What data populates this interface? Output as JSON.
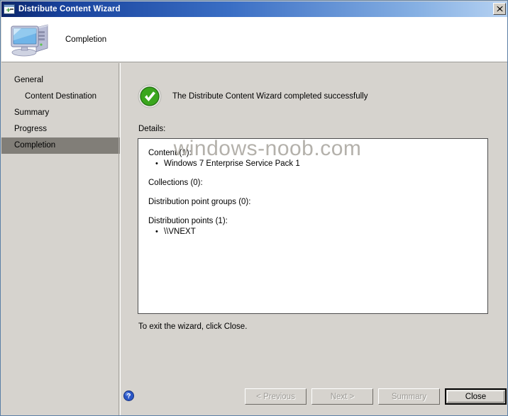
{
  "window": {
    "title": "Distribute Content Wizard",
    "title_icon": "wizard-window-icon",
    "close_label": "✕"
  },
  "header": {
    "icon": "computer-icon",
    "title": "Completion"
  },
  "sidebar": {
    "items": [
      {
        "label": "General",
        "indent": false,
        "selected": false
      },
      {
        "label": "Content Destination",
        "indent": true,
        "selected": false
      },
      {
        "label": "Summary",
        "indent": false,
        "selected": false
      },
      {
        "label": "Progress",
        "indent": false,
        "selected": false
      },
      {
        "label": "Completion",
        "indent": false,
        "selected": true
      }
    ]
  },
  "main": {
    "status_icon": "green-check-circle-icon",
    "success_message": "The Distribute Content Wizard completed successfully",
    "details_label": "Details:",
    "details": [
      {
        "heading": "Content (1):",
        "items": [
          "Windows 7 Enterprise Service Pack 1"
        ]
      },
      {
        "heading": "Collections (0):",
        "items": []
      },
      {
        "heading": "Distribution point groups (0):",
        "items": []
      },
      {
        "heading": "Distribution points (1):",
        "items": [
          "\\\\VNEXT"
        ]
      }
    ],
    "exit_hint": "To exit the wizard, click Close."
  },
  "footer": {
    "help_icon": "help-question-icon",
    "watermark": "windows-noob.com",
    "buttons": [
      {
        "label": "< Previous",
        "disabled": true,
        "default": false
      },
      {
        "label": "Next >",
        "disabled": true,
        "default": false
      },
      {
        "label": "Summary",
        "disabled": true,
        "default": false
      },
      {
        "label": "Close",
        "disabled": false,
        "default": true
      }
    ]
  },
  "colors": {
    "title_bar_start": "#0a246a",
    "title_bar_end": "#b6d2f2",
    "dialog_face": "#d6d3ce",
    "selection": "#817e78",
    "success_green": "#3aa61d",
    "help_blue": "#2a56c6",
    "watermark_gray": "#b4b1ab"
  }
}
